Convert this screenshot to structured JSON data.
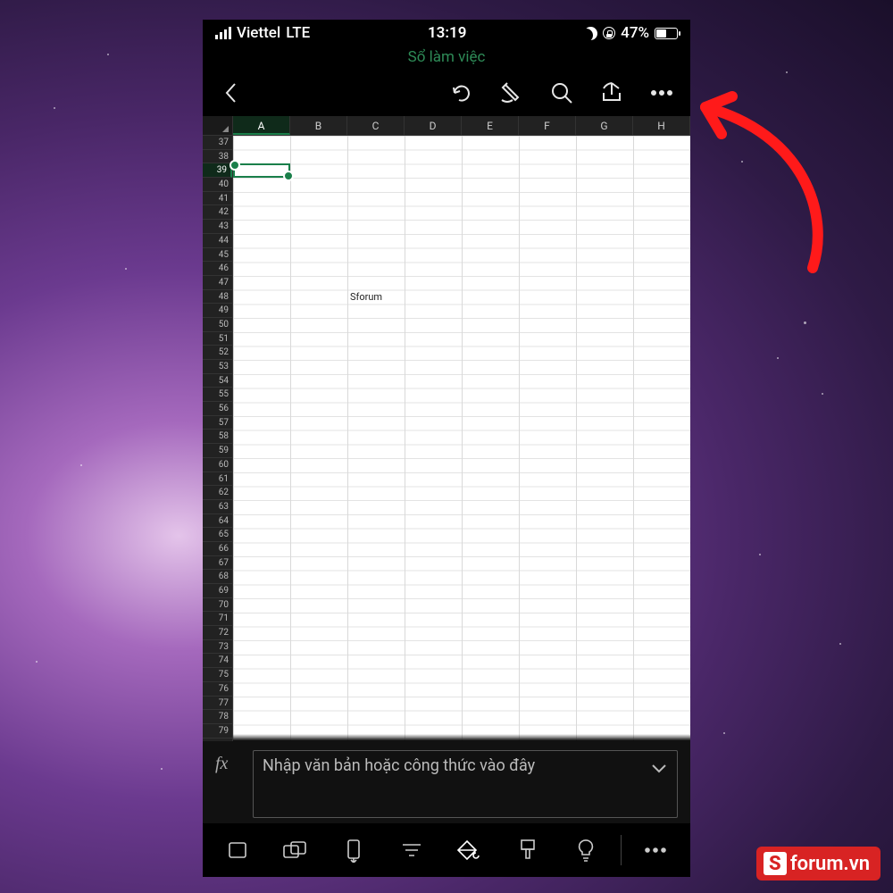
{
  "statusbar": {
    "carrier": "Viettel",
    "network": "LTE",
    "time": "13:19",
    "battery_pct": "47%"
  },
  "header": {
    "doc_title": "Sổ làm việc"
  },
  "spreadsheet": {
    "columns": [
      "A",
      "B",
      "C",
      "D",
      "E",
      "F",
      "G",
      "H"
    ],
    "selected_column": "A",
    "row_start": 37,
    "row_end": 79,
    "selected_row": 39,
    "cells": [
      {
        "col": "C",
        "row": 48,
        "value": "Sforum"
      }
    ]
  },
  "formula_bar": {
    "fx_label": "fx",
    "placeholder": "Nhập văn bản hoặc công thức vào đây"
  },
  "bottom_icons": [
    "card",
    "cards",
    "phone-arrow",
    "filter",
    "fill",
    "brush",
    "bulb",
    "more"
  ],
  "watermark": {
    "badge": "S",
    "text": "forum.vn"
  }
}
